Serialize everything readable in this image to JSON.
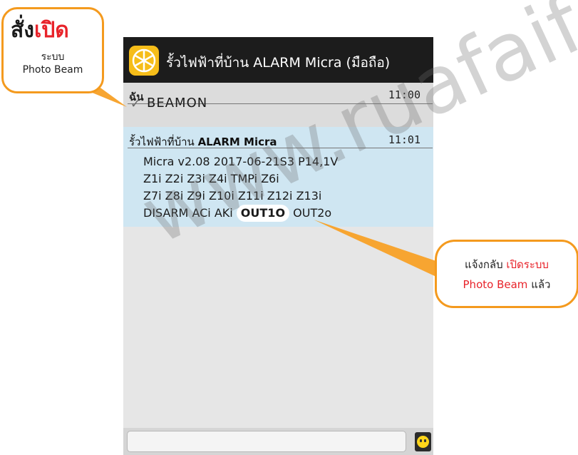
{
  "app": {
    "title": "รั้วไฟฟ้าที่บ้าน ALARM Micra (มือถือ)",
    "icon": "photo-beam-app-icon",
    "accent": "#f6bd19"
  },
  "outgoing": {
    "sender": "ฉัน",
    "time": "11:00",
    "check": "✓",
    "text": "BEAMON"
  },
  "incoming": {
    "sender_prefix": "รั้วไฟฟ้าที่บ้าน",
    "sender_bold": "ALARM  Micra",
    "time": "11:01",
    "lines": [
      "Micra v2.08 2017-06-21S3 P14,1V",
      "Z1i  Z2i  Z3i  Z4i  TMPi  Z6i",
      "Z7i  Z8i  Z9i  Z10i Z11i  Z12i  Z13i"
    ],
    "last_line_prefix": "DISARM  ACi AKi",
    "highlight": "OUT1O",
    "last_line_suffix": "OUT2o"
  },
  "callout_command": {
    "word1": "สั่ง",
    "word2": "เปิด",
    "line2": "ระบบ",
    "line3": "Photo Beam"
  },
  "callout_reply": {
    "line1_a": "แจ้งกลับ",
    "line1_b": "เปิดระบบ",
    "line2_a": "Photo Beam",
    "line2_b": "แล้ว"
  },
  "watermark": "www.ruafaifa.com",
  "colors": {
    "callout_border": "#f49a1e",
    "highlight_red": "#e8232a",
    "incoming_bg": "#cfe6f2"
  }
}
